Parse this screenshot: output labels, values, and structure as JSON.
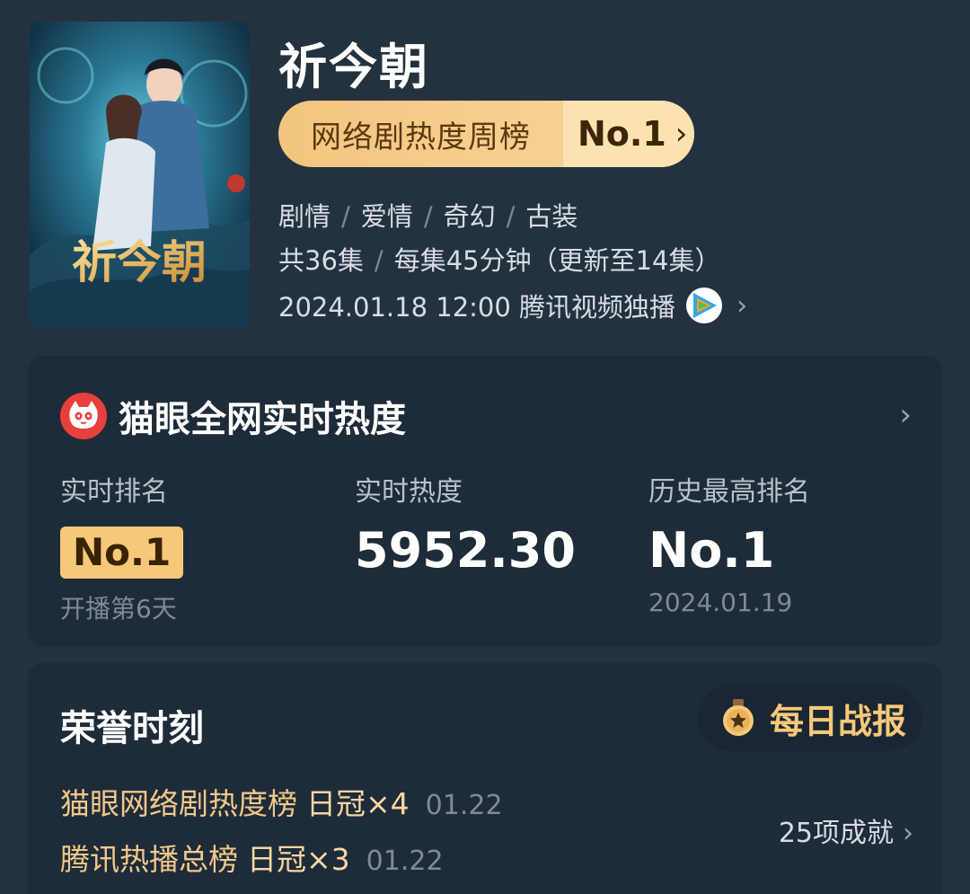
{
  "show": {
    "title": "祈今朝",
    "poster_caption": "祈今朝",
    "rank_label": "网络剧热度周榜",
    "rank_value": "No.1",
    "genres": [
      "剧情",
      "爱情",
      "奇幻",
      "古装"
    ],
    "episodes": "共36集",
    "duration": "每集45分钟（更新至14集）",
    "release": "2024.01.18 12:00 腾讯视频独播"
  },
  "heat": {
    "title": "猫眼全网实时热度",
    "realtime_rank_label": "实时排名",
    "realtime_rank_value": "No.1",
    "realtime_rank_sub": "开播第6天",
    "heat_label": "实时热度",
    "heat_value": "5952.30",
    "best_rank_label": "历史最高排名",
    "best_rank_value": "No.1",
    "best_rank_date": "2024.01.19"
  },
  "honor": {
    "title": "荣誉时刻",
    "daily_report": "每日战报",
    "items": [
      {
        "name": "猫眼网络剧热度榜",
        "crown": "日冠×4",
        "date": "01.22"
      },
      {
        "name": "腾讯热播总榜",
        "crown": "日冠×3",
        "date": "01.22"
      }
    ],
    "achievements": "25项成就"
  },
  "icons": {
    "chevron": "chevron-right-icon",
    "maoyan": "maoyan-cat-icon",
    "tencent": "tencent-video-icon",
    "medal": "medal-icon"
  },
  "colors": {
    "background": "#243240",
    "card": "#1e2b39",
    "gold": "#f6c877",
    "maoyan_red": "#e8413d"
  }
}
